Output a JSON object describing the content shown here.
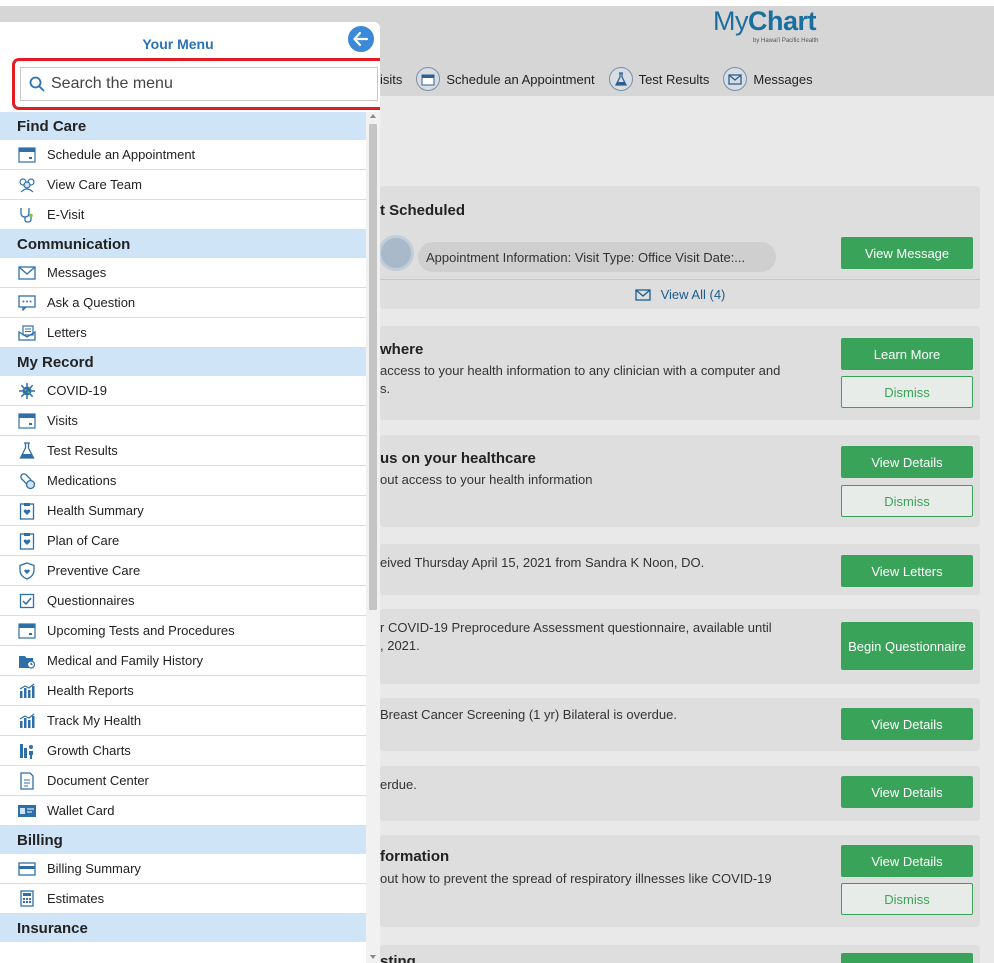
{
  "brand": {
    "name_light": "My",
    "name_bold": "Chart",
    "sub": "by Hawai'i Pacific Health"
  },
  "quicklinks": [
    {
      "label": "isits",
      "icon": "calendar-icon"
    },
    {
      "label": "Schedule an Appointment",
      "icon": "calendar-icon"
    },
    {
      "label": "Test Results",
      "icon": "flask-icon"
    },
    {
      "label": "Messages",
      "icon": "envelope-icon"
    }
  ],
  "cards": {
    "appointment": {
      "title": "t Scheduled",
      "message": "Appointment Information: Visit Type: Office Visit Date:...",
      "button": "View Message",
      "view_all": "View All (4)"
    },
    "everywhere": {
      "title": "where",
      "text": "access to your health information to any clinician with a computer and",
      "text2": "s.",
      "button": "Learn More",
      "dismiss": "Dismiss"
    },
    "healthcare": {
      "title": "us on your healthcare",
      "text": "out access to your health information",
      "button": "View Details",
      "dismiss": "Dismiss"
    },
    "letters": {
      "text": "eived Thursday April 15, 2021 from Sandra K Noon, DO.",
      "button": "View Letters"
    },
    "questionnaire": {
      "text": "r COVID-19 Preprocedure Assessment questionnaire, available until",
      "text2": ", 2021.",
      "button": "Begin Questionnaire"
    },
    "screening": {
      "text": "Breast Cancer Screening (1 yr) Bilateral is overdue.",
      "button": "View Details"
    },
    "overdue": {
      "text": "erdue.",
      "button": "View Details"
    },
    "information": {
      "title": "formation",
      "text": "out how to prevent the spread of respiratory illnesses like COVID-19",
      "button": "View Details",
      "dismiss": "Dismiss"
    },
    "bottom_partial": {
      "title": "sting"
    }
  },
  "menu": {
    "title": "Your Menu",
    "search_placeholder": "Search the menu",
    "sections": [
      {
        "title": "Find Care",
        "items": [
          {
            "label": "Schedule an Appointment",
            "icon": "calendar-icon"
          },
          {
            "label": "View Care Team",
            "icon": "care-team-icon"
          },
          {
            "label": "E-Visit",
            "icon": "stethoscope-icon"
          }
        ]
      },
      {
        "title": "Communication",
        "items": [
          {
            "label": "Messages",
            "icon": "envelope-icon"
          },
          {
            "label": "Ask a Question",
            "icon": "chat-bubble-icon"
          },
          {
            "label": "Letters",
            "icon": "letter-icon"
          }
        ]
      },
      {
        "title": "My Record",
        "items": [
          {
            "label": "COVID-19",
            "icon": "virus-icon"
          },
          {
            "label": "Visits",
            "icon": "calendar-icon"
          },
          {
            "label": "Test Results",
            "icon": "flask-icon"
          },
          {
            "label": "Medications",
            "icon": "pills-icon"
          },
          {
            "label": "Health Summary",
            "icon": "clipboard-heart-icon"
          },
          {
            "label": "Plan of Care",
            "icon": "clipboard-heart-icon"
          },
          {
            "label": "Preventive Care",
            "icon": "shield-heart-icon"
          },
          {
            "label": "Questionnaires",
            "icon": "checkbox-icon"
          },
          {
            "label": "Upcoming Tests and Procedures",
            "icon": "calendar-icon"
          },
          {
            "label": "Medical and Family History",
            "icon": "folder-history-icon"
          },
          {
            "label": "Health Reports",
            "icon": "bar-chart-icon"
          },
          {
            "label": "Track My Health",
            "icon": "bar-chart-icon"
          },
          {
            "label": "Growth Charts",
            "icon": "growth-chart-icon"
          },
          {
            "label": "Document Center",
            "icon": "document-icon"
          },
          {
            "label": "Wallet Card",
            "icon": "id-card-icon"
          }
        ]
      },
      {
        "title": "Billing",
        "items": [
          {
            "label": "Billing Summary",
            "icon": "credit-card-icon"
          },
          {
            "label": "Estimates",
            "icon": "calculator-icon"
          }
        ]
      },
      {
        "title": "Insurance",
        "items": []
      }
    ]
  },
  "colors": {
    "accent_blue": "#2a73b4",
    "green": "#3aa35a",
    "section_bg": "#cfe4f7",
    "highlight_red": "#e31b23"
  }
}
